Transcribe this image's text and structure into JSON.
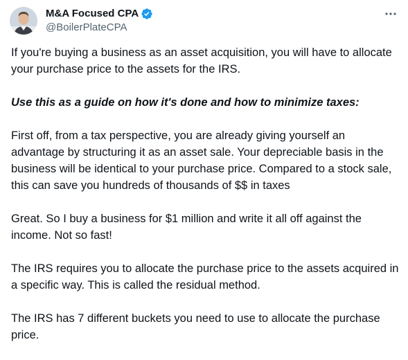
{
  "author": {
    "display_name": "M&A Focused CPA",
    "handle": "@BoilerPlateCPA",
    "verified": true
  },
  "icons": {
    "verified": "verified-badge-icon",
    "more": "more-horizontal-icon"
  },
  "colors": {
    "verified": "#1d9bf0",
    "text": "#0f1419",
    "secondary": "#536471"
  },
  "tweet": {
    "paragraphs": [
      "If you're buying a business as an asset acquisition, you will have to allocate your purchase price to the assets for the IRS.",
      "Use this as a guide on how it's done and how to minimize taxes:",
      "First off, from a tax perspective, you are already giving yourself an advantage by structuring it as an asset sale. Your depreciable basis in the business will be identical to your purchase price. Compared to a stock sale, this can save you hundreds of thousands of $$ in taxes",
      "Great. So I buy a business for $1 million and write it all off against the income. Not so fast!",
      "The IRS requires you to allocate the purchase price to the assets acquired in a specific way. This is called the residual method.",
      "The IRS has 7 different buckets you need to use to allocate the purchase price."
    ]
  }
}
